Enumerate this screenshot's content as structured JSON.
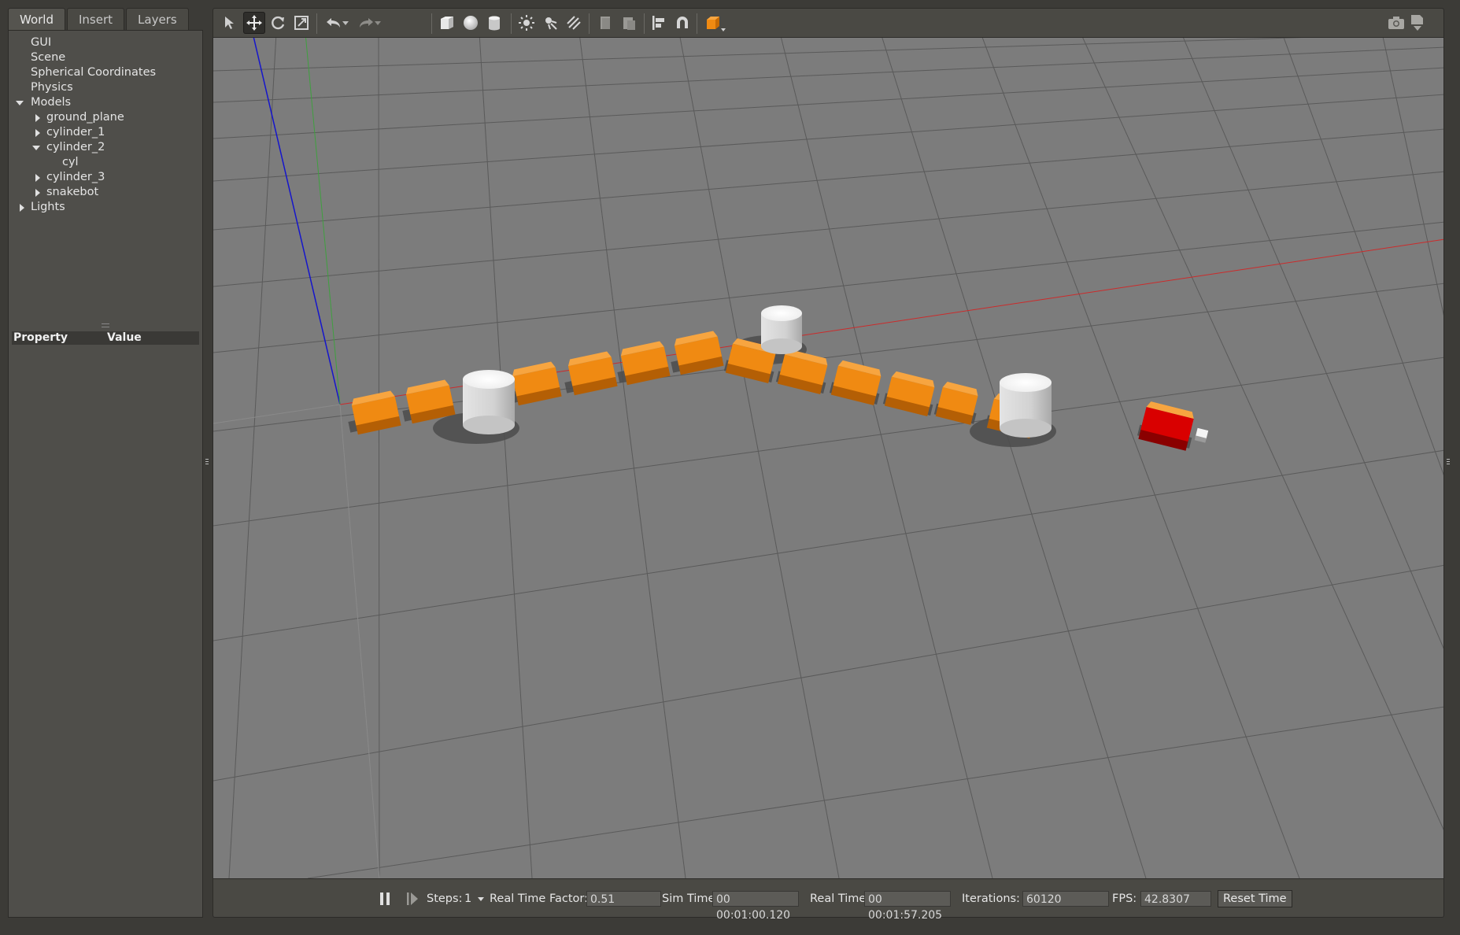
{
  "left_panel": {
    "tabs": [
      {
        "label": "World",
        "active": true
      },
      {
        "label": "Insert",
        "active": false
      },
      {
        "label": "Layers",
        "active": false
      }
    ],
    "tree": [
      {
        "label": "GUI",
        "level": 1,
        "expander": "none"
      },
      {
        "label": "Scene",
        "level": 1,
        "expander": "none"
      },
      {
        "label": "Spherical Coordinates",
        "level": 1,
        "expander": "none"
      },
      {
        "label": "Physics",
        "level": 1,
        "expander": "none"
      },
      {
        "label": "Models",
        "level": 1,
        "expander": "expanded"
      },
      {
        "label": "ground_plane",
        "level": 2,
        "expander": "collapsed"
      },
      {
        "label": "cylinder_1",
        "level": 2,
        "expander": "collapsed"
      },
      {
        "label": "cylinder_2",
        "level": 2,
        "expander": "expanded"
      },
      {
        "label": "cyl",
        "level": 3,
        "expander": "none"
      },
      {
        "label": "cylinder_3",
        "level": 2,
        "expander": "collapsed"
      },
      {
        "label": "snakebot",
        "level": 2,
        "expander": "collapsed"
      },
      {
        "label": "Lights",
        "level": 1,
        "expander": "collapsed"
      }
    ],
    "properties": {
      "col_property": "Property",
      "col_value": "Value"
    }
  },
  "toolbar": {
    "tools": [
      "select-arrow-icon",
      "translate-mode-icon",
      "rotate-mode-icon",
      "scale-mode-icon",
      "undo-icon",
      "undo-history-icon",
      "redo-icon",
      "redo-history-icon",
      "box-shape-icon",
      "sphere-shape-icon",
      "cylinder-shape-icon",
      "point-light-icon",
      "spot-light-icon",
      "directional-light-icon",
      "copy-icon",
      "paste-icon",
      "align-icon",
      "snap-icon",
      "view-angle-icon",
      "screenshot-icon",
      "record-log-icon"
    ],
    "active_tool": "translate-mode-icon"
  },
  "viewport": {
    "background": "#7c7c7c",
    "grid_color": "#5a5a5a",
    "axis_colors": {
      "x": "#cc2b2b",
      "y": "#3fa03f",
      "z": "#1515cc"
    },
    "link_color": "#f08a12",
    "head_color": "#d90000",
    "cylinder_color": "#e6e6e6"
  },
  "bottom_bar": {
    "steps_label": "Steps:",
    "steps_value": "1",
    "rtf_label": "Real Time Factor:",
    "rtf_value": "0.51",
    "sim_time_label": "Sim Time:",
    "sim_time_value": "00 00:01:00.120",
    "real_time_label": "Real Time:",
    "real_time_value": "00 00:01:57.205",
    "iterations_label": "Iterations:",
    "iterations_value": "60120",
    "fps_label": "FPS:",
    "fps_value": "42.8307",
    "reset_label": "Reset Time"
  }
}
